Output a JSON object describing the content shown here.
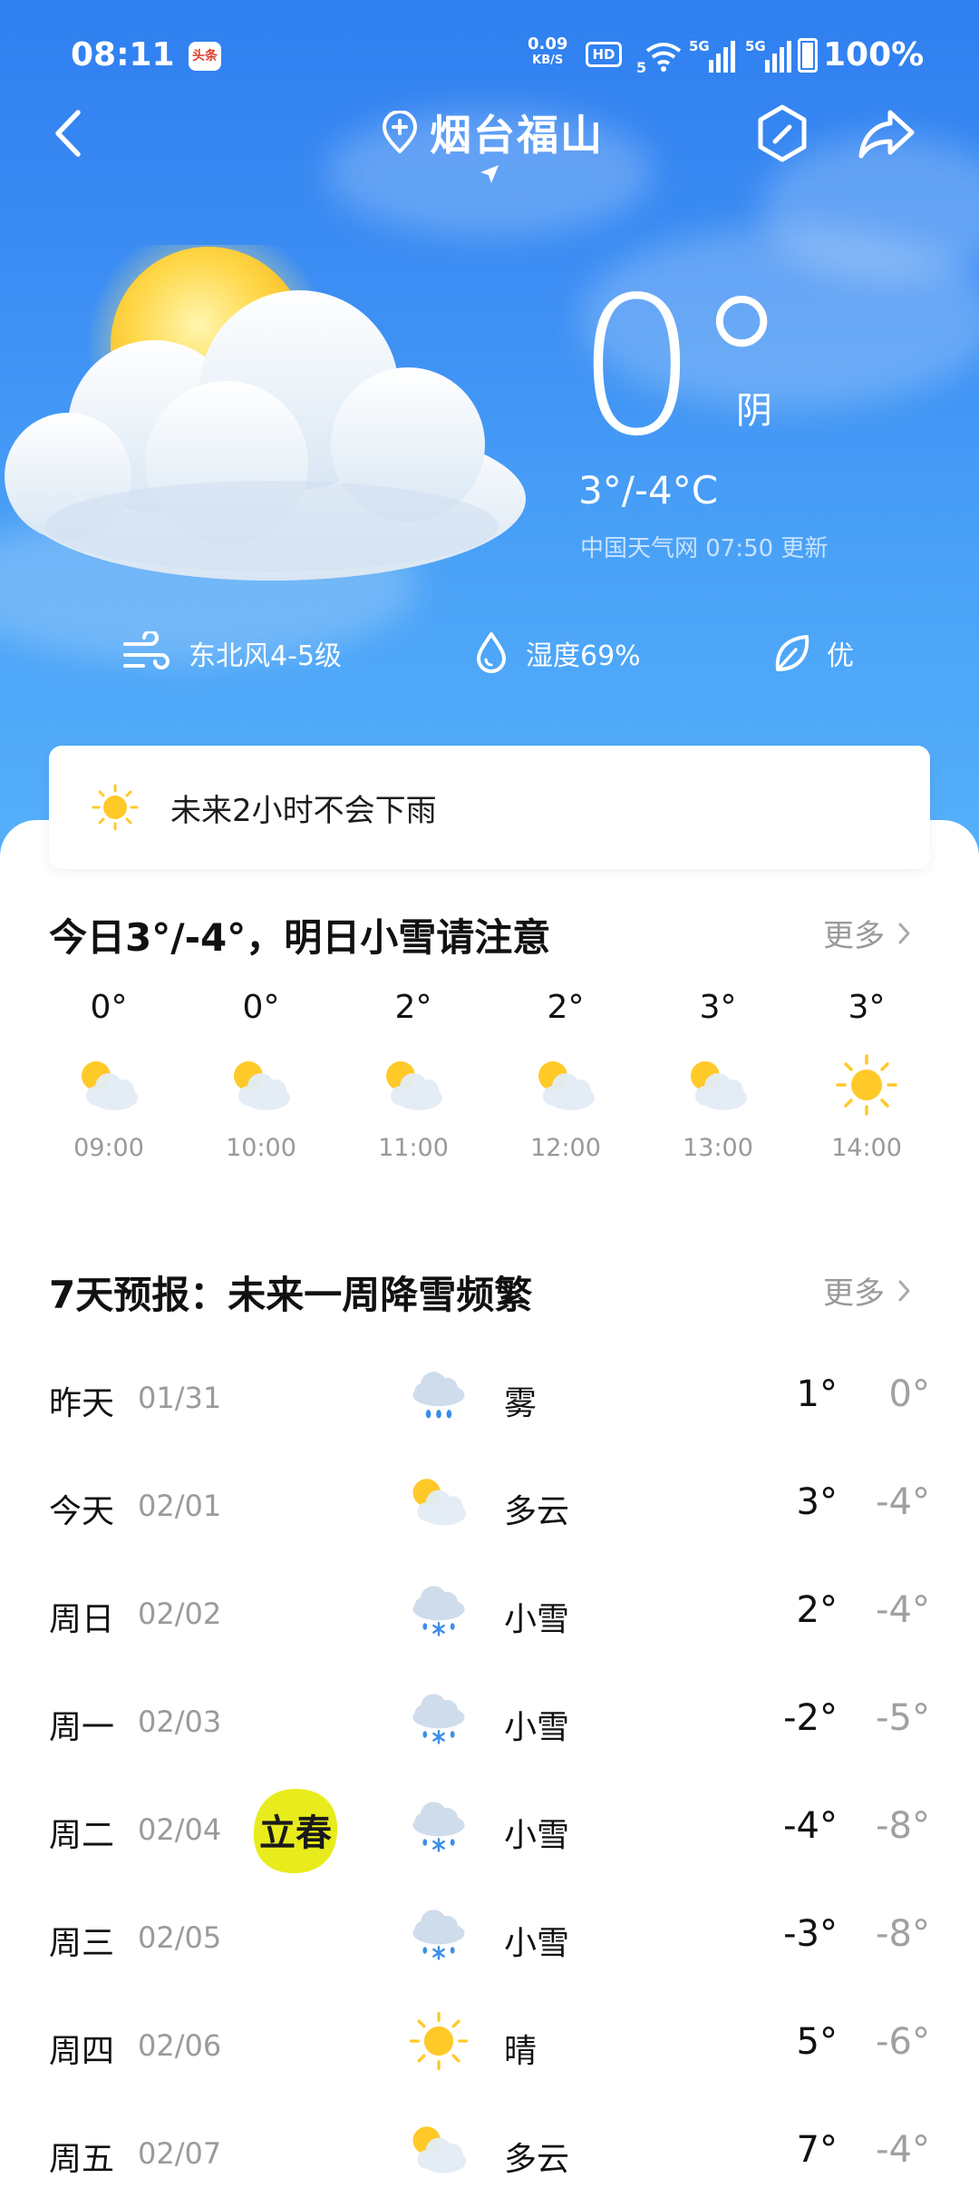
{
  "status_bar": {
    "time": "08:11",
    "app_badge": "头条",
    "net_speed_value": "0.09",
    "net_speed_unit": "KB/S",
    "hd_label": "HD",
    "wifi_label": "5",
    "sim1_label": "5G",
    "sim2_label": "5G",
    "battery": "100%"
  },
  "header": {
    "location": "烟台福山",
    "back_icon": "chevron-left-icon",
    "settings_icon": "hexagon-icon",
    "share_icon": "share-arrow-icon"
  },
  "current": {
    "temperature": "0°",
    "condition": "阴",
    "range": "3°/-4°C",
    "source": "中国天气网 07:50 更新",
    "illustration": "sun-behind-cloud"
  },
  "metrics": [
    {
      "icon": "wind-icon",
      "label": "东北风4-5级"
    },
    {
      "icon": "humidity-drop-icon",
      "label": "湿度69%"
    },
    {
      "icon": "leaf-icon",
      "label": "优"
    }
  ],
  "rain_notice": {
    "icon": "sun-icon",
    "text": "未来2小时不会下雨"
  },
  "hourly": {
    "title": "今日3°/-4°，明日小雪请注意",
    "more": "更多",
    "items": [
      {
        "temp": "0°",
        "icon": "partly-cloudy",
        "time": "09:00"
      },
      {
        "temp": "0°",
        "icon": "partly-cloudy",
        "time": "10:00"
      },
      {
        "temp": "2°",
        "icon": "partly-cloudy",
        "time": "11:00"
      },
      {
        "temp": "2°",
        "icon": "partly-cloudy",
        "time": "12:00"
      },
      {
        "temp": "3°",
        "icon": "partly-cloudy",
        "time": "13:00"
      },
      {
        "temp": "3°",
        "icon": "sunny",
        "time": "14:00"
      }
    ]
  },
  "daily": {
    "title": "7天预报：未来一周降雪频繁",
    "more": "更多",
    "items": [
      {
        "day": "昨天",
        "date": "01/31",
        "icon": "fog",
        "cond": "雾",
        "high": "1°",
        "low": "0°"
      },
      {
        "day": "今天",
        "date": "02/01",
        "icon": "partly-cloudy",
        "cond": "多云",
        "high": "3°",
        "low": "-4°"
      },
      {
        "day": "周日",
        "date": "02/02",
        "icon": "light-snow",
        "cond": "小雪",
        "high": "2°",
        "low": "-4°"
      },
      {
        "day": "周一",
        "date": "02/03",
        "icon": "light-snow",
        "cond": "小雪",
        "high": "-2°",
        "low": "-5°"
      },
      {
        "day": "周二",
        "date": "02/04",
        "icon": "light-snow",
        "cond": "小雪",
        "high": "-4°",
        "low": "-8°"
      },
      {
        "day": "周三",
        "date": "02/05",
        "icon": "light-snow",
        "cond": "小雪",
        "high": "-3°",
        "low": "-8°"
      },
      {
        "day": "周四",
        "date": "02/06",
        "icon": "sunny",
        "cond": "晴",
        "high": "5°",
        "low": "-6°"
      },
      {
        "day": "周五",
        "date": "02/07",
        "icon": "partly-cloudy",
        "cond": "多云",
        "high": "7°",
        "low": "-4°"
      }
    ],
    "solar_term_badge": "立春"
  },
  "colors": {
    "sky_top": "#2f7ff0",
    "sky_bottom": "#56b0fa",
    "sun": "#ffc928",
    "muted_text": "#9a9a9a"
  }
}
